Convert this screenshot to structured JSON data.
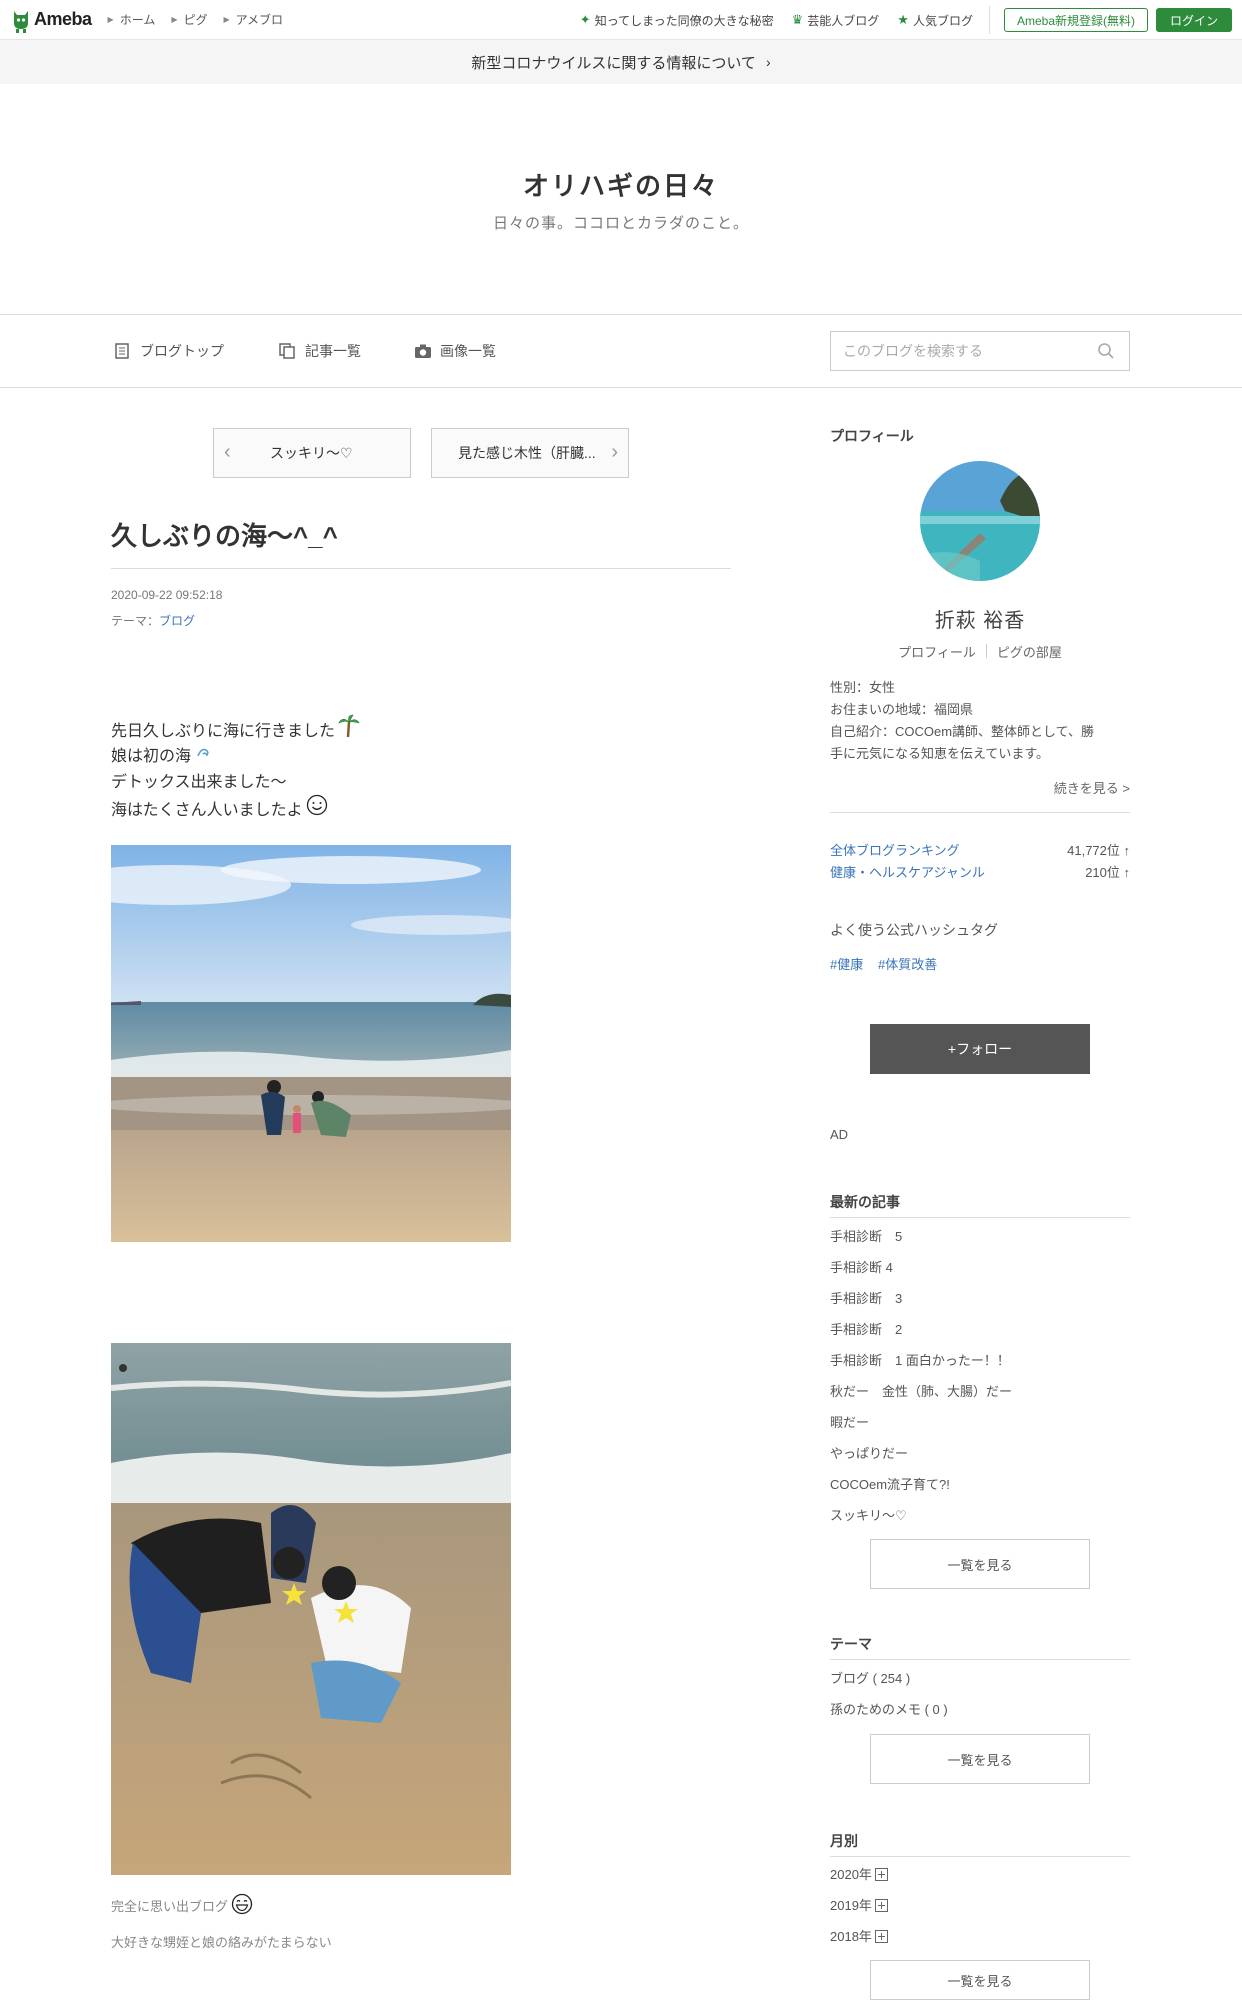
{
  "topbar": {
    "logo_text": "Ameba",
    "breadcrumbs": [
      "ホーム",
      "ピグ",
      "アメブロ"
    ],
    "links": [
      {
        "icon": "sparkle-icon",
        "label": "知ってしまった同僚の大きな秘密"
      },
      {
        "icon": "crown-icon",
        "label": "芸能人ブログ"
      },
      {
        "icon": "star-icon",
        "label": "人気ブログ"
      }
    ],
    "register_label": "Ameba新規登録(無料)",
    "login_label": "ログイン"
  },
  "notice": {
    "text": "新型コロナウイルスに関する情報について",
    "chevron": "›"
  },
  "blog": {
    "title": "オリハギの日々",
    "subtitle": "日々の事。ココロとカラダのこと。"
  },
  "nav": {
    "items": [
      {
        "icon": "document-icon",
        "label": "ブログトップ"
      },
      {
        "icon": "copy-icon",
        "label": "記事一覧"
      },
      {
        "icon": "camera-icon",
        "label": "画像一覧"
      }
    ],
    "search_placeholder": "このブログを検索する"
  },
  "pager": {
    "prev_label": "スッキリ〜♡",
    "next_label": "見た感じ木性（肝臓..."
  },
  "post": {
    "title": "久しぶりの海〜^_^",
    "date": "2020-09-22 09:52:18",
    "theme_prefix": "テーマ：",
    "theme": "ブログ",
    "lines": [
      "先日久しぶりに海に行きました",
      "娘は初の海",
      "デトックス出来ました〜",
      "海はたくさん人いましたよ"
    ],
    "captions": [
      "完全に思い出ブログ",
      "大好きな甥姪と娘の絡みがたまらない"
    ]
  },
  "sidebar": {
    "profile_heading": "プロフィール",
    "name": "折萩 裕香",
    "profile_link": "プロフィール",
    "pig_link": "ピグの部屋",
    "gender": "性別：女性",
    "region": "お住まいの地域：福岡県",
    "intro_1": "自己紹介：COCOem講師、整体師として、勝",
    "intro_2": "手に元気になる知恵を伝えています。",
    "more": "続きを見る >",
    "rankings": [
      {
        "label": "全体ブログランキング",
        "value": "41,772位 ↑"
      },
      {
        "label": "健康・ヘルスケアジャンル",
        "value": "210位 ↑"
      }
    ],
    "hashtag_heading": "よく使う公式ハッシュタグ",
    "hashtags": [
      "#健康",
      "#体質改善"
    ],
    "follow_label": "+フォロー",
    "ad_label": "AD",
    "recent_heading": "最新の記事",
    "recent": [
      "手相診断　5",
      "手相診断 4",
      "手相診断　3",
      "手相診断　2",
      "手相診断　1 面白かったー！！",
      "秋だー　金性（肺、大腸）だー",
      "暇だー",
      "やっぱりだー",
      "COCOem流子育て?!",
      "スッキリ〜♡"
    ],
    "list_label": "一覧を見る",
    "theme_heading": "テーマ",
    "themes": [
      "ブログ ( 254 )",
      "孫のためのメモ ( 0 )"
    ],
    "monthly_heading": "月別",
    "months": [
      "2020年",
      "2019年",
      "2018年"
    ]
  }
}
